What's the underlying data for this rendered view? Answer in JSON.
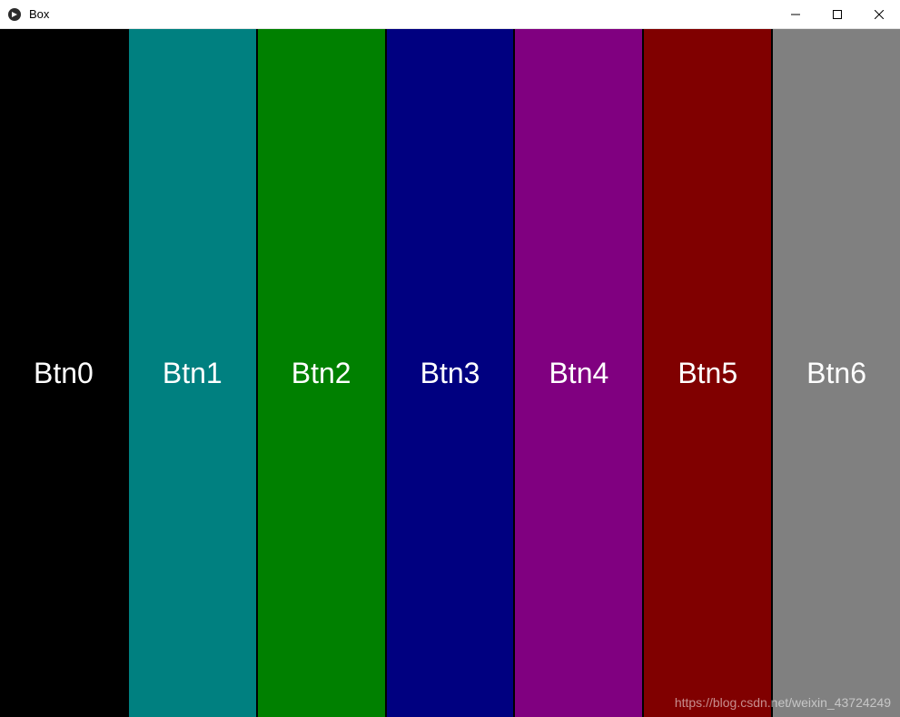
{
  "window": {
    "title": "Box"
  },
  "buttons": [
    {
      "label": "Btn0",
      "color": "#000000"
    },
    {
      "label": "Btn1",
      "color": "#008080"
    },
    {
      "label": "Btn2",
      "color": "#008000"
    },
    {
      "label": "Btn3",
      "color": "#000080"
    },
    {
      "label": "Btn4",
      "color": "#800080"
    },
    {
      "label": "Btn5",
      "color": "#800000"
    },
    {
      "label": "Btn6",
      "color": "#808080"
    }
  ],
  "watermark": "https://blog.csdn.net/weixin_43724249"
}
